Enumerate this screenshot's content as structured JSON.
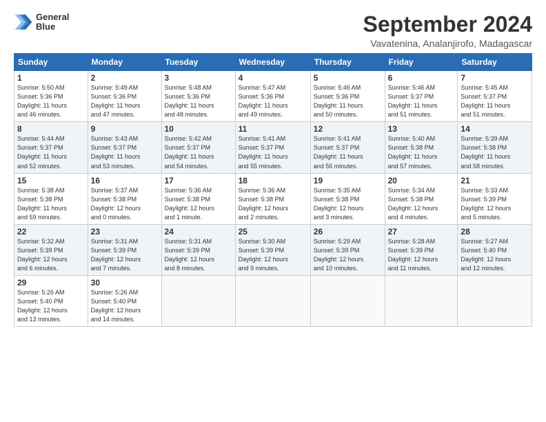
{
  "logo": {
    "line1": "General",
    "line2": "Blue"
  },
  "title": "September 2024",
  "location": "Vavatenina, Analanjirofo, Madagascar",
  "days_of_week": [
    "Sunday",
    "Monday",
    "Tuesday",
    "Wednesday",
    "Thursday",
    "Friday",
    "Saturday"
  ],
  "weeks": [
    [
      {
        "day": "1",
        "info": "Sunrise: 5:50 AM\nSunset: 5:36 PM\nDaylight: 11 hours\nand 46 minutes."
      },
      {
        "day": "2",
        "info": "Sunrise: 5:49 AM\nSunset: 5:36 PM\nDaylight: 11 hours\nand 47 minutes."
      },
      {
        "day": "3",
        "info": "Sunrise: 5:48 AM\nSunset: 5:36 PM\nDaylight: 11 hours\nand 48 minutes."
      },
      {
        "day": "4",
        "info": "Sunrise: 5:47 AM\nSunset: 5:36 PM\nDaylight: 11 hours\nand 49 minutes."
      },
      {
        "day": "5",
        "info": "Sunrise: 5:46 AM\nSunset: 5:36 PM\nDaylight: 11 hours\nand 50 minutes."
      },
      {
        "day": "6",
        "info": "Sunrise: 5:46 AM\nSunset: 5:37 PM\nDaylight: 11 hours\nand 51 minutes."
      },
      {
        "day": "7",
        "info": "Sunrise: 5:45 AM\nSunset: 5:37 PM\nDaylight: 11 hours\nand 51 minutes."
      }
    ],
    [
      {
        "day": "8",
        "info": "Sunrise: 5:44 AM\nSunset: 5:37 PM\nDaylight: 11 hours\nand 52 minutes."
      },
      {
        "day": "9",
        "info": "Sunrise: 5:43 AM\nSunset: 5:37 PM\nDaylight: 11 hours\nand 53 minutes."
      },
      {
        "day": "10",
        "info": "Sunrise: 5:42 AM\nSunset: 5:37 PM\nDaylight: 11 hours\nand 54 minutes."
      },
      {
        "day": "11",
        "info": "Sunrise: 5:41 AM\nSunset: 5:37 PM\nDaylight: 11 hours\nand 55 minutes."
      },
      {
        "day": "12",
        "info": "Sunrise: 5:41 AM\nSunset: 5:37 PM\nDaylight: 11 hours\nand 56 minutes."
      },
      {
        "day": "13",
        "info": "Sunrise: 5:40 AM\nSunset: 5:38 PM\nDaylight: 11 hours\nand 57 minutes."
      },
      {
        "day": "14",
        "info": "Sunrise: 5:39 AM\nSunset: 5:38 PM\nDaylight: 11 hours\nand 58 minutes."
      }
    ],
    [
      {
        "day": "15",
        "info": "Sunrise: 5:38 AM\nSunset: 5:38 PM\nDaylight: 11 hours\nand 59 minutes."
      },
      {
        "day": "16",
        "info": "Sunrise: 5:37 AM\nSunset: 5:38 PM\nDaylight: 12 hours\nand 0 minutes."
      },
      {
        "day": "17",
        "info": "Sunrise: 5:36 AM\nSunset: 5:38 PM\nDaylight: 12 hours\nand 1 minute."
      },
      {
        "day": "18",
        "info": "Sunrise: 5:36 AM\nSunset: 5:38 PM\nDaylight: 12 hours\nand 2 minutes."
      },
      {
        "day": "19",
        "info": "Sunrise: 5:35 AM\nSunset: 5:38 PM\nDaylight: 12 hours\nand 3 minutes."
      },
      {
        "day": "20",
        "info": "Sunrise: 5:34 AM\nSunset: 5:38 PM\nDaylight: 12 hours\nand 4 minutes."
      },
      {
        "day": "21",
        "info": "Sunrise: 5:33 AM\nSunset: 5:39 PM\nDaylight: 12 hours\nand 5 minutes."
      }
    ],
    [
      {
        "day": "22",
        "info": "Sunrise: 5:32 AM\nSunset: 5:39 PM\nDaylight: 12 hours\nand 6 minutes."
      },
      {
        "day": "23",
        "info": "Sunrise: 5:31 AM\nSunset: 5:39 PM\nDaylight: 12 hours\nand 7 minutes."
      },
      {
        "day": "24",
        "info": "Sunrise: 5:31 AM\nSunset: 5:39 PM\nDaylight: 12 hours\nand 8 minutes."
      },
      {
        "day": "25",
        "info": "Sunrise: 5:30 AM\nSunset: 5:39 PM\nDaylight: 12 hours\nand 9 minutes."
      },
      {
        "day": "26",
        "info": "Sunrise: 5:29 AM\nSunset: 5:39 PM\nDaylight: 12 hours\nand 10 minutes."
      },
      {
        "day": "27",
        "info": "Sunrise: 5:28 AM\nSunset: 5:39 PM\nDaylight: 12 hours\nand 11 minutes."
      },
      {
        "day": "28",
        "info": "Sunrise: 5:27 AM\nSunset: 5:40 PM\nDaylight: 12 hours\nand 12 minutes."
      }
    ],
    [
      {
        "day": "29",
        "info": "Sunrise: 5:26 AM\nSunset: 5:40 PM\nDaylight: 12 hours\nand 13 minutes."
      },
      {
        "day": "30",
        "info": "Sunrise: 5:26 AM\nSunset: 5:40 PM\nDaylight: 12 hours\nand 14 minutes."
      },
      {
        "day": "",
        "info": ""
      },
      {
        "day": "",
        "info": ""
      },
      {
        "day": "",
        "info": ""
      },
      {
        "day": "",
        "info": ""
      },
      {
        "day": "",
        "info": ""
      }
    ]
  ]
}
